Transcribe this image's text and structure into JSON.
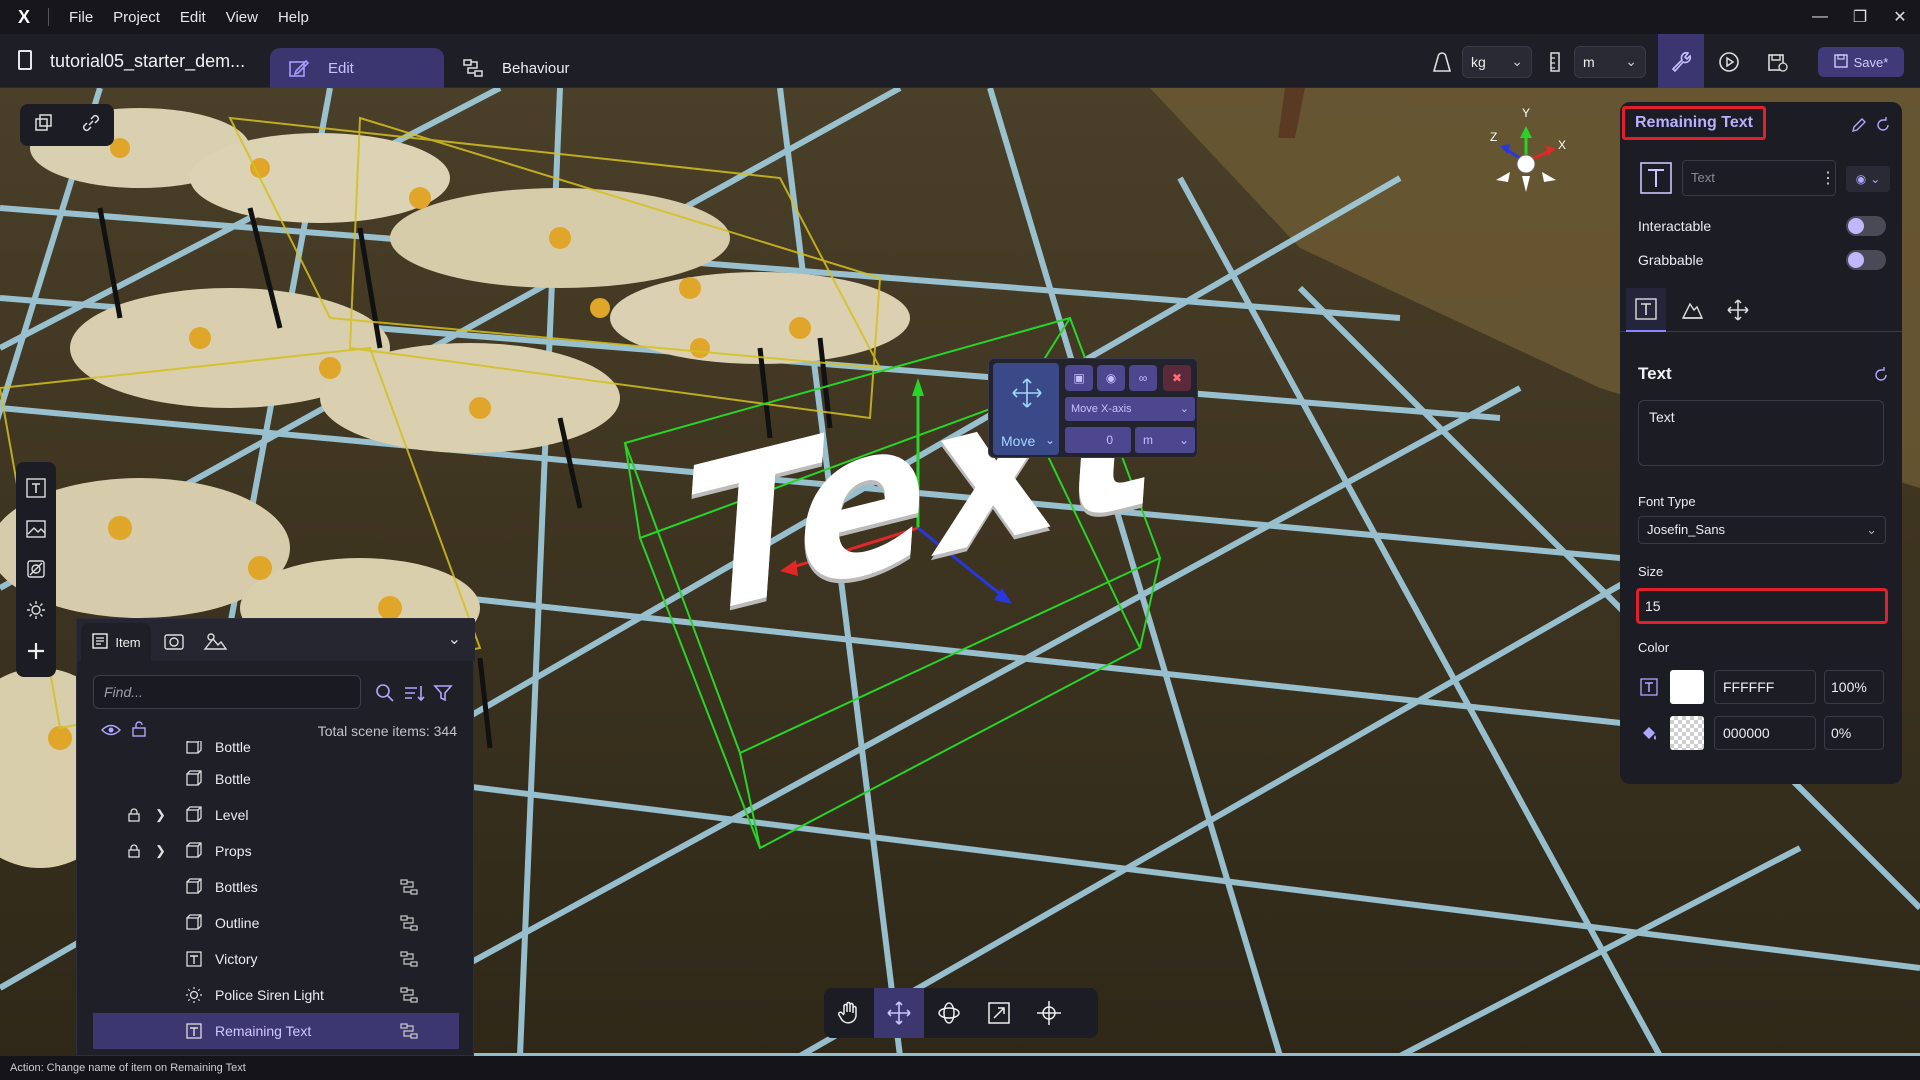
{
  "menubar": {
    "logo": "X",
    "items": [
      "File",
      "Project",
      "Edit",
      "View",
      "Help"
    ]
  },
  "toolbar": {
    "project_title": "tutorial05_starter_dem...",
    "tabs": [
      {
        "label": "Edit"
      },
      {
        "label": "Behaviour"
      }
    ],
    "mass_unit": "kg",
    "length_unit": "m",
    "save_label": "Save*"
  },
  "viewport": {
    "scene_text": "Text",
    "navcube": {
      "y": "Y",
      "x": "X",
      "z": "Z"
    }
  },
  "gizmo": {
    "mode_label": "Move",
    "axis_label": "Move X-axis",
    "value": "0",
    "unit": "m"
  },
  "outliner": {
    "tab_label": "Item",
    "search_placeholder": "Find...",
    "total_label": "Total scene items: 344",
    "rows": [
      {
        "label": "Bottle",
        "icon": "cube-icon",
        "locked": false,
        "expandable": false,
        "link": false,
        "selected": false
      },
      {
        "label": "Bottle",
        "icon": "cube-icon",
        "locked": false,
        "expandable": false,
        "link": false,
        "selected": false
      },
      {
        "label": "Level",
        "icon": "cube-icon",
        "locked": true,
        "expandable": true,
        "link": false,
        "selected": false
      },
      {
        "label": "Props",
        "icon": "cube-icon",
        "locked": true,
        "expandable": true,
        "link": false,
        "selected": false
      },
      {
        "label": "Bottles",
        "icon": "cube-icon",
        "locked": false,
        "expandable": false,
        "link": true,
        "selected": false
      },
      {
        "label": "Outline",
        "icon": "cube-icon",
        "locked": false,
        "expandable": false,
        "link": true,
        "selected": false
      },
      {
        "label": "Victory",
        "icon": "text-icon",
        "locked": false,
        "expandable": false,
        "link": true,
        "selected": false
      },
      {
        "label": "Police Siren Light",
        "icon": "light-icon",
        "locked": false,
        "expandable": false,
        "link": true,
        "selected": false
      },
      {
        "label": "Remaining Text",
        "icon": "text-icon",
        "locked": false,
        "expandable": false,
        "link": true,
        "selected": true
      }
    ]
  },
  "inspector": {
    "title": "Remaining Text",
    "name_placeholder": "Text",
    "interactable_label": "Interactable",
    "grabbable_label": "Grabbable",
    "section_title": "Text",
    "text_value": "Text",
    "font_type_label": "Font Type",
    "font_type_value": "Josefin_Sans",
    "size_label": "Size",
    "size_value": "15",
    "color_label": "Color",
    "text_color_hex": "FFFFFF",
    "text_color_opacity": "100%",
    "bg_color_hex": "000000",
    "bg_color_opacity": "0%"
  },
  "statusbar": {
    "text": "Action: Change name of item on Remaining Text"
  },
  "colors": {
    "accent": "#3b3670",
    "highlight_red": "#e0202a",
    "grid": "#a8d8ec"
  }
}
